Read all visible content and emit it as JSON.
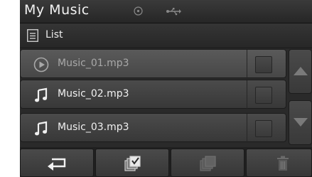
{
  "header": {
    "title": "My Music",
    "status_icons": [
      "disc-icon",
      "usb-icon"
    ]
  },
  "list_header": {
    "label": "List",
    "icon": "list-icon"
  },
  "files": [
    {
      "name": "Music_01.mp3",
      "icon": "play-icon",
      "dimmed": true
    },
    {
      "name": "Music_02.mp3",
      "icon": "music-note-icon",
      "dimmed": false
    },
    {
      "name": "Music_03.mp3",
      "icon": "music-note-icon",
      "dimmed": false
    }
  ],
  "scroll": {
    "up_icon": "scroll-up-icon",
    "down_icon": "scroll-down-icon"
  },
  "bottom_bar": {
    "buttons": [
      "back-icon",
      "select-all-icon",
      "unselect-all-icon",
      "delete-icon"
    ]
  }
}
